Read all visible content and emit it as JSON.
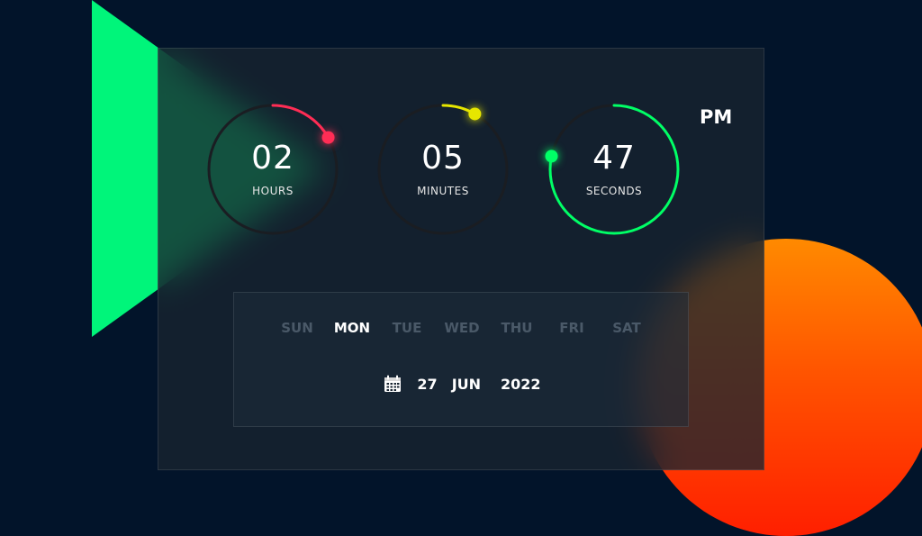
{
  "clock": {
    "hours": {
      "value": "02",
      "label": "HOURS",
      "color": "#ff2d55",
      "fraction": 0.167
    },
    "minutes": {
      "value": "05",
      "label": "MINUTES",
      "color": "#e6e600",
      "fraction": 0.083
    },
    "seconds": {
      "value": "47",
      "label": "SECONDS",
      "color": "#00ff66",
      "fraction": 0.783
    },
    "period": "PM"
  },
  "weekdays": {
    "items": [
      "SUN",
      "MON",
      "TUE",
      "WED",
      "THU",
      "FRI",
      "SAT"
    ],
    "active": "MON"
  },
  "date": {
    "day": "27",
    "month": "JUN",
    "year": "2022",
    "icon": "calendar-icon"
  },
  "colors": {
    "background": "#02142a",
    "triangle": "#00f57a",
    "circle_top": "#ff8a00",
    "circle_bottom": "#ff1f00",
    "ring_track": "#1a1d22"
  }
}
